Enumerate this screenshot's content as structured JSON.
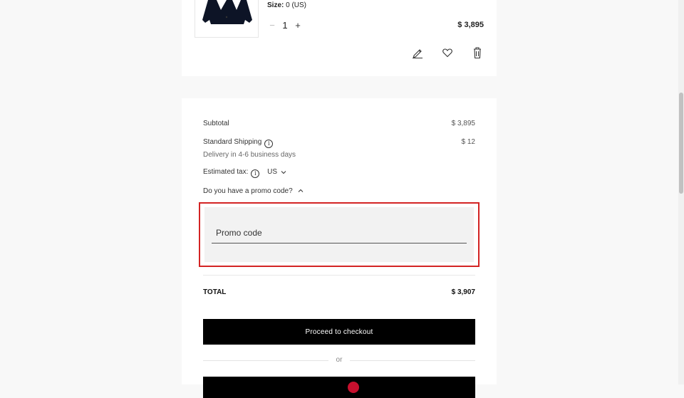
{
  "product": {
    "size_label": "Size:",
    "size_value": "0 (US)",
    "qty_minus": "−",
    "quantity": "1",
    "qty_plus": "+",
    "price": "$ 3,895",
    "actions": [
      {
        "name": "edit-icon"
      },
      {
        "name": "heart-icon"
      },
      {
        "name": "trash-icon"
      }
    ]
  },
  "summary": {
    "subtotal_label": "Subtotal",
    "subtotal_value": "$ 3,895",
    "shipping_label": "Standard Shipping",
    "shipping_value": "$ 12",
    "shipping_note": "Delivery in 4-6 business days",
    "tax_label": "Estimated tax:",
    "tax_country": "US",
    "promo_toggle": "Do you have a promo code?",
    "promo_placeholder": "Promo code",
    "total_label": "TOTAL",
    "total_value": "$ 3,907",
    "checkout_label": "Proceed to checkout",
    "or_label": "or"
  },
  "colors": {
    "highlight": "#d32424",
    "button": "#000000",
    "background": "#f8f8f8"
  }
}
